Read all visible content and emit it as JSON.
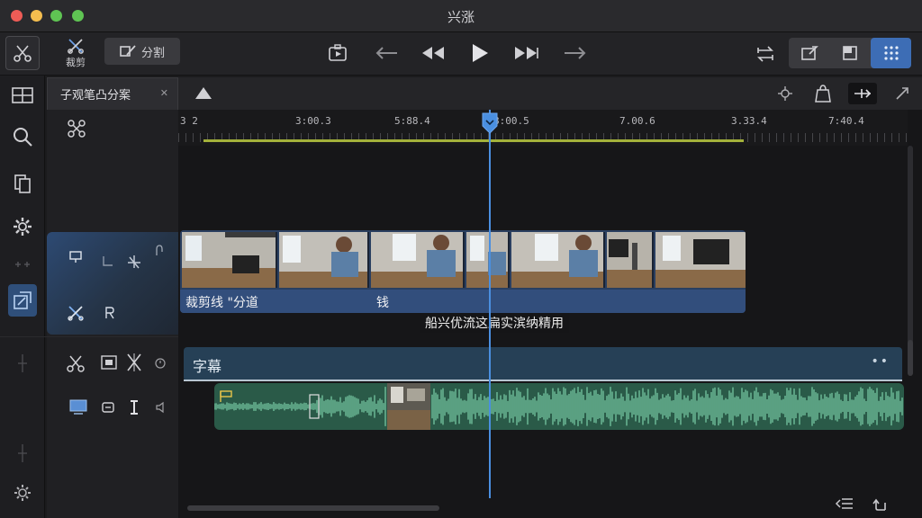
{
  "window": {
    "title": "兴涨"
  },
  "toolbar": {
    "trim_label": "裁剪",
    "split_label": "分割"
  },
  "tabs": [
    {
      "label": "子观笔凸分案"
    }
  ],
  "ruler": {
    "ticks": [
      "3 2",
      "3:00.3",
      "5:88.4",
      "8:00.5",
      "7.00.6",
      "3.33.4",
      "7:40.4"
    ]
  },
  "video_track": {
    "clip_labels": [
      "裁剪线 \"分道",
      "钱"
    ]
  },
  "subtitle_overlay": "船兴优流这扁实滨纳精用",
  "caption_track": {
    "label": "字幕",
    "menu": "••"
  },
  "colors": {
    "accent": "#3d6db5",
    "playhead": "#4a8fe0",
    "audio": "#2a5a48",
    "video_label_bar": "#324e7c"
  }
}
